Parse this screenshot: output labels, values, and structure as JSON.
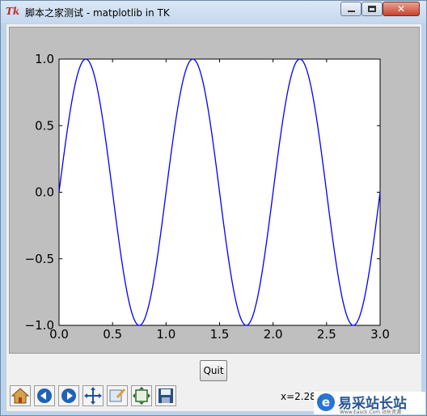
{
  "window": {
    "title": "脚本之家测试 - matplotlib in TK",
    "tk_logo": "Tk",
    "close_glyph": "✕"
  },
  "quit_label": "Quit",
  "coords_text": "x=2.283",
  "watermark": {
    "text": "易采站长站",
    "subtext": "Www.Easck.Com  站长资源",
    "logo": "e"
  },
  "toolbar": {
    "items": [
      "home-icon",
      "back-icon",
      "forward-icon",
      "pan-icon",
      "zoom-icon",
      "subplots-icon",
      "save-icon"
    ]
  },
  "chart_data": {
    "type": "line",
    "function": "sin(2*pi*x)",
    "x_range": [
      0.0,
      3.0
    ],
    "ylim": [
      -1.0,
      1.0
    ],
    "xticks": [
      "0.0",
      "0.5",
      "1.0",
      "1.5",
      "2.0",
      "2.5",
      "3.0"
    ],
    "yticks": [
      "1.0",
      "0.5",
      "0.0",
      "−0.5",
      "−1.0"
    ],
    "series": [
      {
        "color": "#0000ff"
      }
    ]
  }
}
